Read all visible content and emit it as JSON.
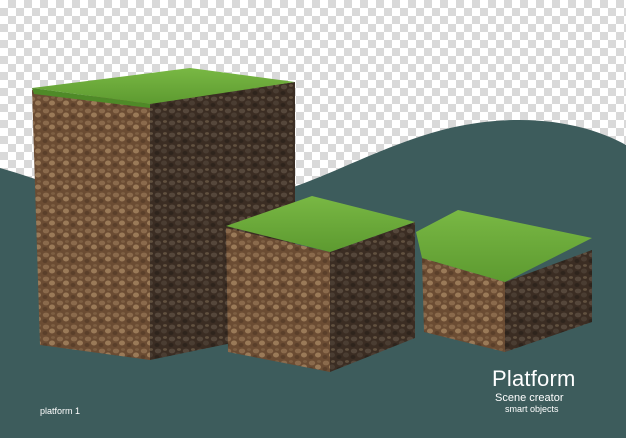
{
  "caption": {
    "title": "Platform",
    "subtitle": "Scene creator",
    "tagline": "smart objects"
  },
  "corner_label": "platform 1",
  "colors": {
    "backdrop": "#3d5c5c",
    "grass": "#6fae3c",
    "soil_light": "#7a5a3c",
    "soil_dark": "#3f3024",
    "text": "#ffffff"
  }
}
